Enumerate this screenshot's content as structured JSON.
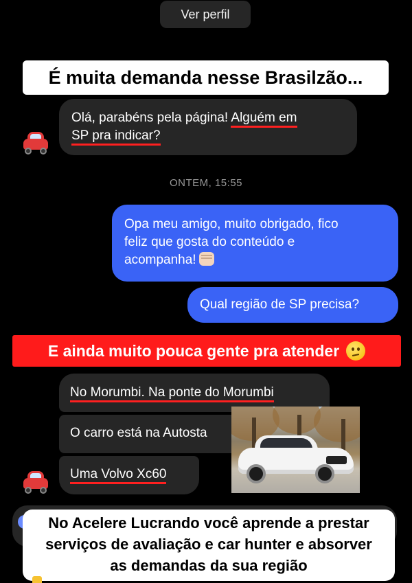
{
  "header": {
    "profile_button": "Ver perfil"
  },
  "captions": {
    "top": "É muita demanda nesse Brasilzão...",
    "middle": "E ainda muito pouca gente pra atender",
    "bottom_lines": [
      "No Acelere Lucrando você aprende a prestar",
      "serviços de avaliação e car hunter e absorver",
      "as demandas da sua região"
    ]
  },
  "messages": {
    "first": {
      "part1": "Olá, parabéns pela página! ",
      "part2": "Alguém em",
      "part3": "SP pra indicar?"
    },
    "timestamp": "ONTEM, 15:55",
    "reply1": {
      "line1": "Opa meu amigo, muito obrigado, fico",
      "line2": "feliz que gosta do conteúdo e",
      "line3": "acompanha!"
    },
    "reply2": "Qual região de SP precisa?",
    "answer1": "No Morumbi. Na ponte do Morumbi",
    "answer2": "O carro está na Autosta",
    "answer3": "Uma Volvo Xc60"
  },
  "icons": {
    "avatar": "red-car-emoji-icon",
    "fist": "fist-bump-emoji-icon",
    "confused": "confused-face-emoji-icon",
    "pointing": "pointing-down-emoji-icon"
  },
  "colors": {
    "background": "#000000",
    "incoming_bubble": "#262626",
    "outgoing_bubble": "#3a63f6",
    "red_caption": "#ff1b1b",
    "underline": "#ff2020"
  }
}
